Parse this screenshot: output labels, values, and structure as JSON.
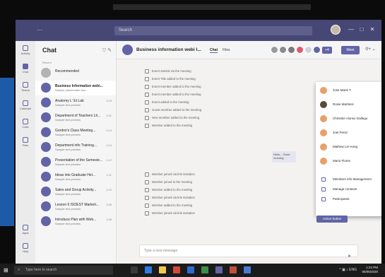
{
  "title_bar": {
    "search_placeholder": "Search",
    "menu_dots": "···",
    "min": "—",
    "max": "□",
    "close": "✕"
  },
  "rail": [
    {
      "label": "Activity"
    },
    {
      "label": "Chat"
    },
    {
      "label": "Teams"
    },
    {
      "label": "Calendar"
    },
    {
      "label": "Calls"
    },
    {
      "label": "Files"
    },
    {
      "label": "Apps"
    },
    {
      "label": "Help"
    }
  ],
  "chat_list": {
    "heading": "Chat",
    "section": "Recent",
    "items": [
      {
        "name": "Recommended",
        "preview": "",
        "time": ""
      },
      {
        "name": "Business Information webi...",
        "preview": "Sample placeholder text...",
        "time": ""
      },
      {
        "name": "Anatomy L' Et Lab",
        "preview": "Sample text preview",
        "time": "1:23"
      },
      {
        "name": "Department of Teachers Lit...",
        "preview": "Sample text preview",
        "time": "1:21"
      },
      {
        "name": "Gordon's Class Meeting...",
        "preview": "Sample text preview",
        "time": "1:14"
      },
      {
        "name": "Department info Training...",
        "preview": "Sample text preview",
        "time": "1:13"
      },
      {
        "name": "Presentation of the Semeste...",
        "preview": "Sample text preview",
        "time": "1:12"
      },
      {
        "name": "Ideas into Graduate Hel...",
        "preview": "Sample text preview",
        "time": "1:11"
      },
      {
        "name": "Sales and Group Activity...",
        "preview": "Sample text preview",
        "time": "1:10"
      },
      {
        "name": "Lesson 6 ISOEST Marketi...",
        "preview": "Sample text preview",
        "time": "1:09"
      },
      {
        "name": "Introduce Plan with Web...",
        "preview": "Sample text preview",
        "time": "1:08"
      }
    ]
  },
  "conversation": {
    "title": "Business information webi I...",
    "tabs": [
      "Chat",
      "Files"
    ],
    "count": "+4",
    "meet_label": "Meet",
    "add_people": "⚲+ ⌄",
    "events_top": [
      "Event started via the meeting",
      "Event Title added to the meeting",
      "Event member added to the meeting",
      "Event member added to the meeting",
      "Event added to the meeting",
      "Guest member added to the meeting",
      "New member added to the meeting",
      "Member added to the meeting"
    ],
    "bubble": "Hello... Good morning",
    "events_bottom": [
      "Member joined via link invitation",
      "Member joined to the meeting",
      "Member added to the meeting",
      "Member joined via link invitation",
      "Member added to the meeting",
      "Member joined via link invitation"
    ],
    "action_button": "Action button",
    "compose_placeholder": "Type a new message",
    "send_icon": "➤"
  },
  "participants_popup": {
    "people": [
      {
        "name": "Jose Marie T.",
        "color": "#e8a06a"
      },
      {
        "name": "Rosie Martinez",
        "color": "#5a4a3a"
      },
      {
        "name": "Christine Alonso Gallego",
        "color": "#e8a06a"
      },
      {
        "name": "Joel Perez",
        "color": "#e8a06a"
      },
      {
        "name": "Mathew Lie Hong",
        "color": "#e8a06a"
      },
      {
        "name": "Mario Flores",
        "color": "#e8a06a"
      }
    ],
    "actions": [
      {
        "label": "Members info Management"
      },
      {
        "label": "Manage contacts"
      },
      {
        "label": "Participants"
      }
    ]
  },
  "taskbar": {
    "search_placeholder": "Type here to search",
    "tray": "^ ▣ ♪ ENG",
    "time": "1:24 PM",
    "date": "05/05/2020"
  }
}
